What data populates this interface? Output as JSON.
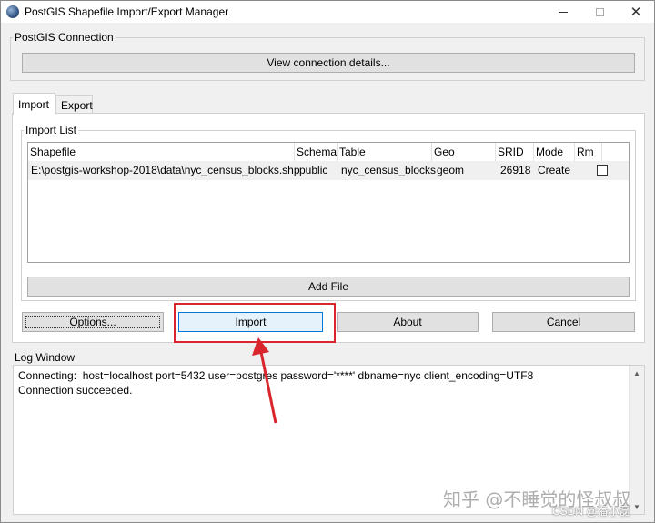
{
  "window": {
    "title": "PostGIS Shapefile Import/Export Manager",
    "minimize": "",
    "maximize": "",
    "close": "✕"
  },
  "connection": {
    "group_label": "PostGIS Connection",
    "view_button": "View connection details..."
  },
  "tabs": [
    {
      "label": "Import",
      "active": true
    },
    {
      "label": "Export",
      "active": false
    }
  ],
  "import_list": {
    "group_label": "Import List",
    "columns": [
      "Shapefile",
      "Schema",
      "Table",
      "Geo Column",
      "SRID",
      "Mode",
      "Rm"
    ],
    "rows": [
      {
        "shapefile": "E:\\postgis-workshop-2018\\data\\nyc_census_blocks.shp",
        "schema": "public",
        "table": "nyc_census_blocks",
        "geo_column": "geom",
        "srid": "26918",
        "mode": "Create",
        "rm": false
      }
    ],
    "add_file_button": "Add File"
  },
  "actions": {
    "options": "Options...",
    "import": "Import",
    "about": "About",
    "cancel": "Cancel"
  },
  "log": {
    "group_label": "Log Window",
    "lines": [
      "Connecting:  host=localhost port=5432 user=postgres password='****' dbname=nyc client_encoding=UTF8",
      "Connection succeeded."
    ]
  },
  "watermark": {
    "main": "知乎 @不睡觉的怪叔叔",
    "small": "CSDN @潘小磊"
  },
  "colors": {
    "annotation_red": "#d9262c",
    "primary_border": "#0078d7"
  }
}
